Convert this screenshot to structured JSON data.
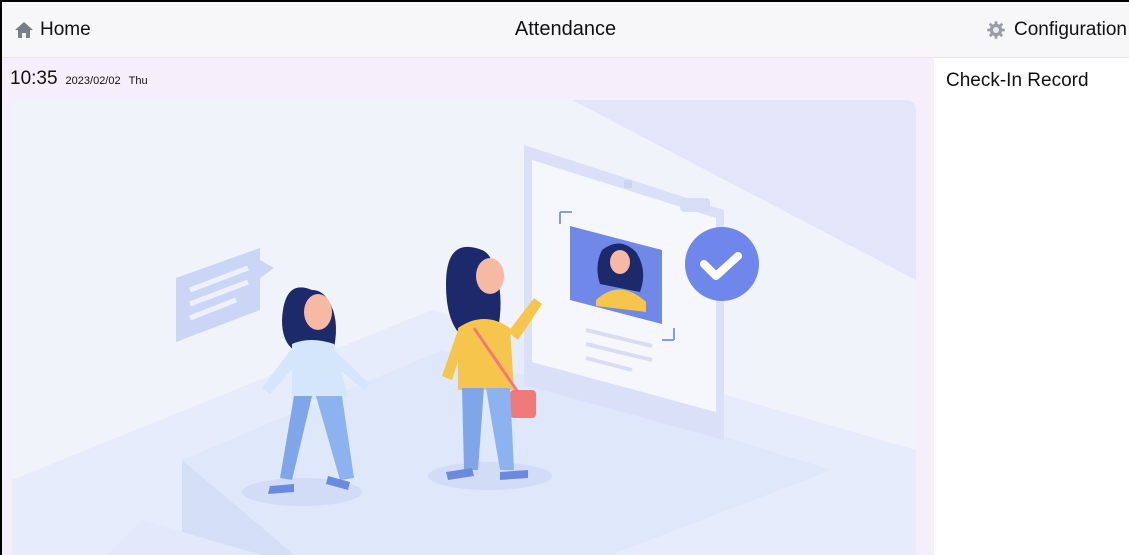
{
  "header": {
    "home_label": "Home",
    "title": "Attendance",
    "config_label": "Configuration"
  },
  "clock": {
    "time": "10:35",
    "date": "2023/02/02",
    "weekday": "Thu"
  },
  "sidebar": {
    "title": "Check-In Record"
  },
  "colors": {
    "accent_blue": "#6f86ea",
    "figure_yellow": "#f6c54b",
    "bag_red": "#f07a7a",
    "hair_navy": "#1c2a6b",
    "panel_bg": "#f4effa"
  },
  "icons": {
    "home": "home-icon",
    "config": "gear-icon",
    "check": "check-icon"
  }
}
